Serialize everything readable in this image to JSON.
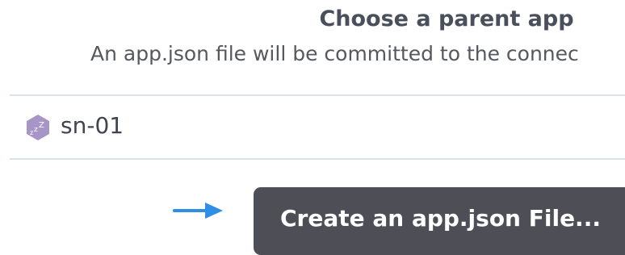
{
  "header": {
    "title": "Choose a parent app",
    "subtitle": "An app.json file will be committed to the connec"
  },
  "app_list": {
    "items": [
      {
        "name": "sn-01",
        "icon": "sleeping-dyno-icon",
        "icon_color": "#a795c8"
      }
    ]
  },
  "actions": {
    "pointer_icon": "arrow-right-icon",
    "pointer_color": "#2f8ee6",
    "create_label": "Create an app.json File...",
    "button_color": "#4e4f56"
  }
}
